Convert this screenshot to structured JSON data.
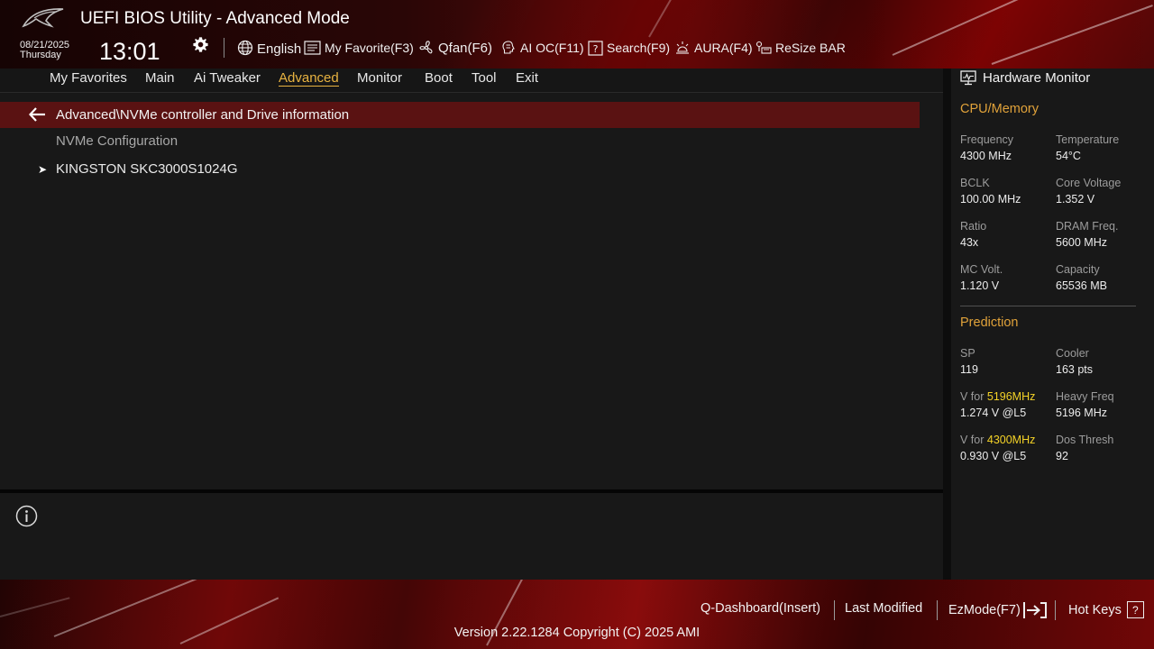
{
  "app": {
    "title": "UEFI BIOS Utility - Advanced Mode",
    "date": "08/21/2025",
    "weekday": "Thursday",
    "time": "13:01"
  },
  "toolbar": {
    "language": "English",
    "favorite": "My Favorite(F3)",
    "qfan": "Qfan(F6)",
    "aioc": "AI OC(F11)",
    "search": "Search(F9)",
    "aura": "AURA(F4)",
    "resizebar": "ReSize BAR"
  },
  "nav": {
    "tabs": [
      {
        "label": "My Favorites",
        "active": false
      },
      {
        "label": "Main",
        "active": false
      },
      {
        "label": "Ai Tweaker",
        "active": false
      },
      {
        "label": "Advanced",
        "active": true
      },
      {
        "label": "Monitor",
        "active": false
      },
      {
        "label": "Boot",
        "active": false
      },
      {
        "label": "Tool",
        "active": false
      },
      {
        "label": "Exit",
        "active": false
      }
    ]
  },
  "main": {
    "path": "Advanced\\NVMe controller and Drive information",
    "section_label": "NVMe Configuration",
    "items": [
      {
        "label": "KINGSTON SKC3000S1024G"
      }
    ]
  },
  "hardware_monitor": {
    "title": "Hardware Monitor",
    "cpu_memory": {
      "heading": "CPU/Memory",
      "frequency": {
        "label": "Frequency",
        "value": "4300 MHz"
      },
      "temperature": {
        "label": "Temperature",
        "value": "54°C"
      },
      "bclk": {
        "label": "BCLK",
        "value": "100.00 MHz"
      },
      "core_voltage": {
        "label": "Core Voltage",
        "value": "1.352 V"
      },
      "ratio": {
        "label": "Ratio",
        "value": "43x"
      },
      "dram_freq": {
        "label": "DRAM Freq.",
        "value": "5600 MHz"
      },
      "mc_volt": {
        "label": "MC Volt.",
        "value": "1.120 V"
      },
      "capacity": {
        "label": "Capacity",
        "value": "65536 MB"
      }
    },
    "prediction": {
      "heading": "Prediction",
      "sp": {
        "label": "SP",
        "value": "119"
      },
      "cooler": {
        "label": "Cooler",
        "value": "163 pts"
      },
      "v_for_1": {
        "label_prefix": "V for ",
        "label_freq": "5196MHz",
        "value": "1.274 V @L5"
      },
      "heavy_freq": {
        "label": "Heavy Freq",
        "value": "5196 MHz"
      },
      "v_for_2": {
        "label_prefix": "V for ",
        "label_freq": "4300MHz",
        "value": "0.930 V @L5"
      },
      "dos_thresh": {
        "label": "Dos Thresh",
        "value": "92"
      }
    }
  },
  "footer": {
    "qdashboard": "Q-Dashboard(Insert)",
    "last_modified": "Last Modified",
    "ezmode": "EzMode(F7)",
    "hotkeys": "Hot Keys",
    "hotkeys_key": "?",
    "version": "Version 2.22.1284 Copyright (C) 2025 AMI"
  },
  "colors": {
    "accent": "#e8b341",
    "path_bar": "#5a1212",
    "highlight": "#f5d327"
  }
}
